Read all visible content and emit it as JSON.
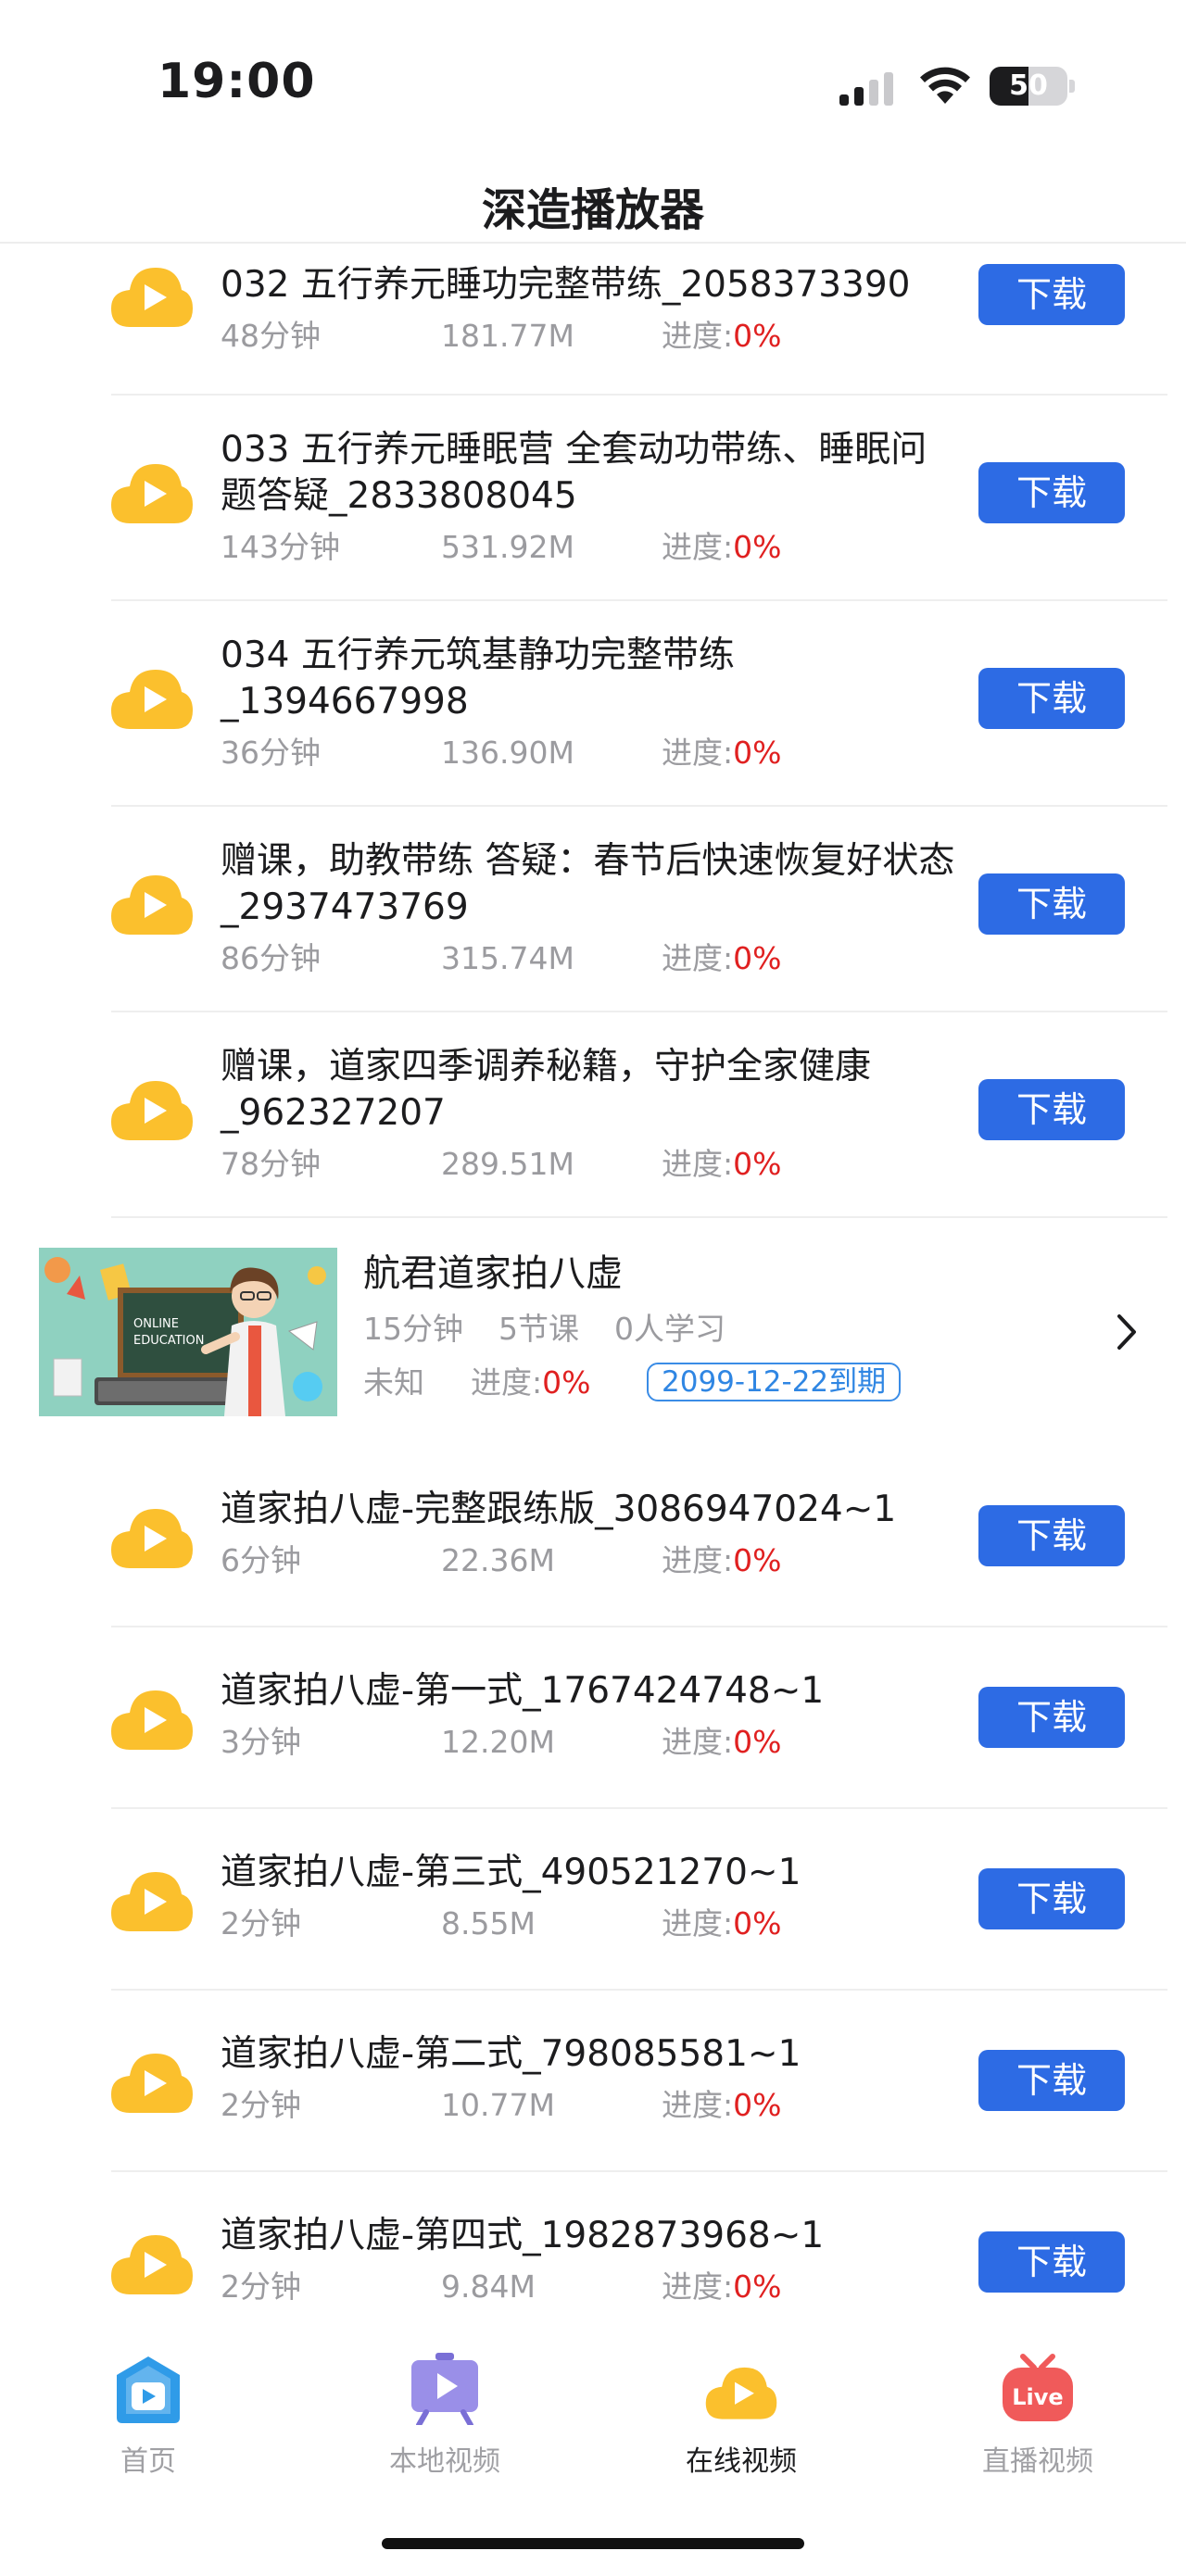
{
  "status_bar": {
    "time": "19:00",
    "battery": "50",
    "battery_level": 0.5
  },
  "nav": {
    "title": "深造播放器"
  },
  "items_top": [
    {
      "title": "032 五行养元睡功完整带练_2058373390",
      "duration": "48分钟",
      "size": "181.77M",
      "progress_label": "进度:",
      "progress_value": "0%",
      "button": "下载"
    },
    {
      "title": "033 五行养元睡眠营 全套动功带练、睡眠问题答疑_2833808045",
      "duration": "143分钟",
      "size": "531.92M",
      "progress_label": "进度:",
      "progress_value": "0%",
      "button": "下载"
    },
    {
      "title": "034 五行养元筑基静功完整带练_1394667998",
      "duration": "36分钟",
      "size": "136.90M",
      "progress_label": "进度:",
      "progress_value": "0%",
      "button": "下载"
    },
    {
      "title": "赠课，助教带练 答疑：春节后快速恢复好状态_2937473769",
      "duration": "86分钟",
      "size": "315.74M",
      "progress_label": "进度:",
      "progress_value": "0%",
      "button": "下载"
    },
    {
      "title": "赠课，道家四季调养秘籍，守护全家健康_962327207",
      "duration": "78分钟",
      "size": "289.51M",
      "progress_label": "进度:",
      "progress_value": "0%",
      "button": "下载"
    }
  ],
  "course": {
    "thumbnail_text_1": "ONLINE",
    "thumbnail_text_2": "EDUCATION",
    "title": "航君道家拍八虚",
    "duration": "15分钟",
    "lessons": "5节课",
    "learners": "0人学习",
    "status": "未知",
    "progress_label": "进度:",
    "progress_value": "0%",
    "expiry": "2099-12-22到期"
  },
  "items_bottom": [
    {
      "title": "道家拍八虚-完整跟练版_3086947024~1",
      "duration": "6分钟",
      "size": "22.36M",
      "progress_label": "进度:",
      "progress_value": "0%",
      "button": "下载"
    },
    {
      "title": "道家拍八虚-第一式_1767424748~1",
      "duration": "3分钟",
      "size": "12.20M",
      "progress_label": "进度:",
      "progress_value": "0%",
      "button": "下载"
    },
    {
      "title": "道家拍八虚-第三式_490521270~1",
      "duration": "2分钟",
      "size": "8.55M",
      "progress_label": "进度:",
      "progress_value": "0%",
      "button": "下载"
    },
    {
      "title": "道家拍八虚-第二式_798085581~1",
      "duration": "2分钟",
      "size": "10.77M",
      "progress_label": "进度:",
      "progress_value": "0%",
      "button": "下载"
    },
    {
      "title": "道家拍八虚-第四式_1982873968~1",
      "duration": "2分钟",
      "size": "9.84M",
      "progress_label": "进度:",
      "progress_value": "0%",
      "button": "下载"
    }
  ],
  "tabs": [
    {
      "label": "首页",
      "icon": "home-icon",
      "active": false
    },
    {
      "label": "本地视频",
      "icon": "local-video-icon",
      "active": false
    },
    {
      "label": "在线视频",
      "icon": "online-video-icon",
      "active": true
    },
    {
      "label": "直播视频",
      "icon": "live-video-icon",
      "active": false,
      "badge": "Live"
    }
  ],
  "colors": {
    "accent": "#2d6be4",
    "progress": "#e02020",
    "cloud": "#fbc02d",
    "expiry_border": "#3a8ce6"
  }
}
